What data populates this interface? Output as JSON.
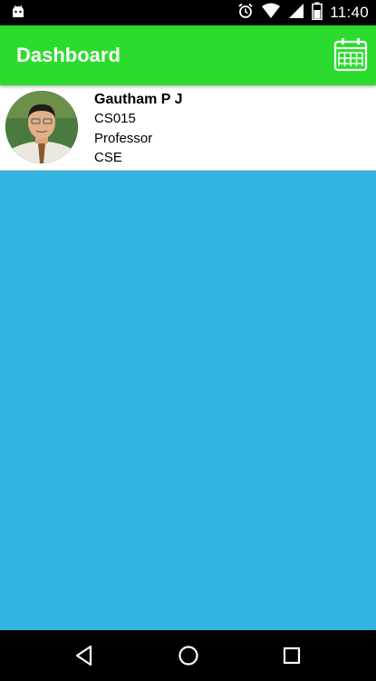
{
  "status_bar": {
    "time": "11:40",
    "icons": [
      "android-icon",
      "alarm-icon",
      "wifi-icon",
      "signal-icon",
      "battery-icon"
    ]
  },
  "app_bar": {
    "title": "Dashboard",
    "action_icon": "calendar-icon",
    "color": "#2bdc2e"
  },
  "profile": {
    "name": "Gautham P J",
    "id": "CS015",
    "designation": "Professor",
    "department": "CSE"
  },
  "content": {
    "background": "#34b4e4"
  },
  "nav_bar": {
    "icons": [
      "back-icon",
      "home-icon",
      "recents-icon"
    ]
  }
}
